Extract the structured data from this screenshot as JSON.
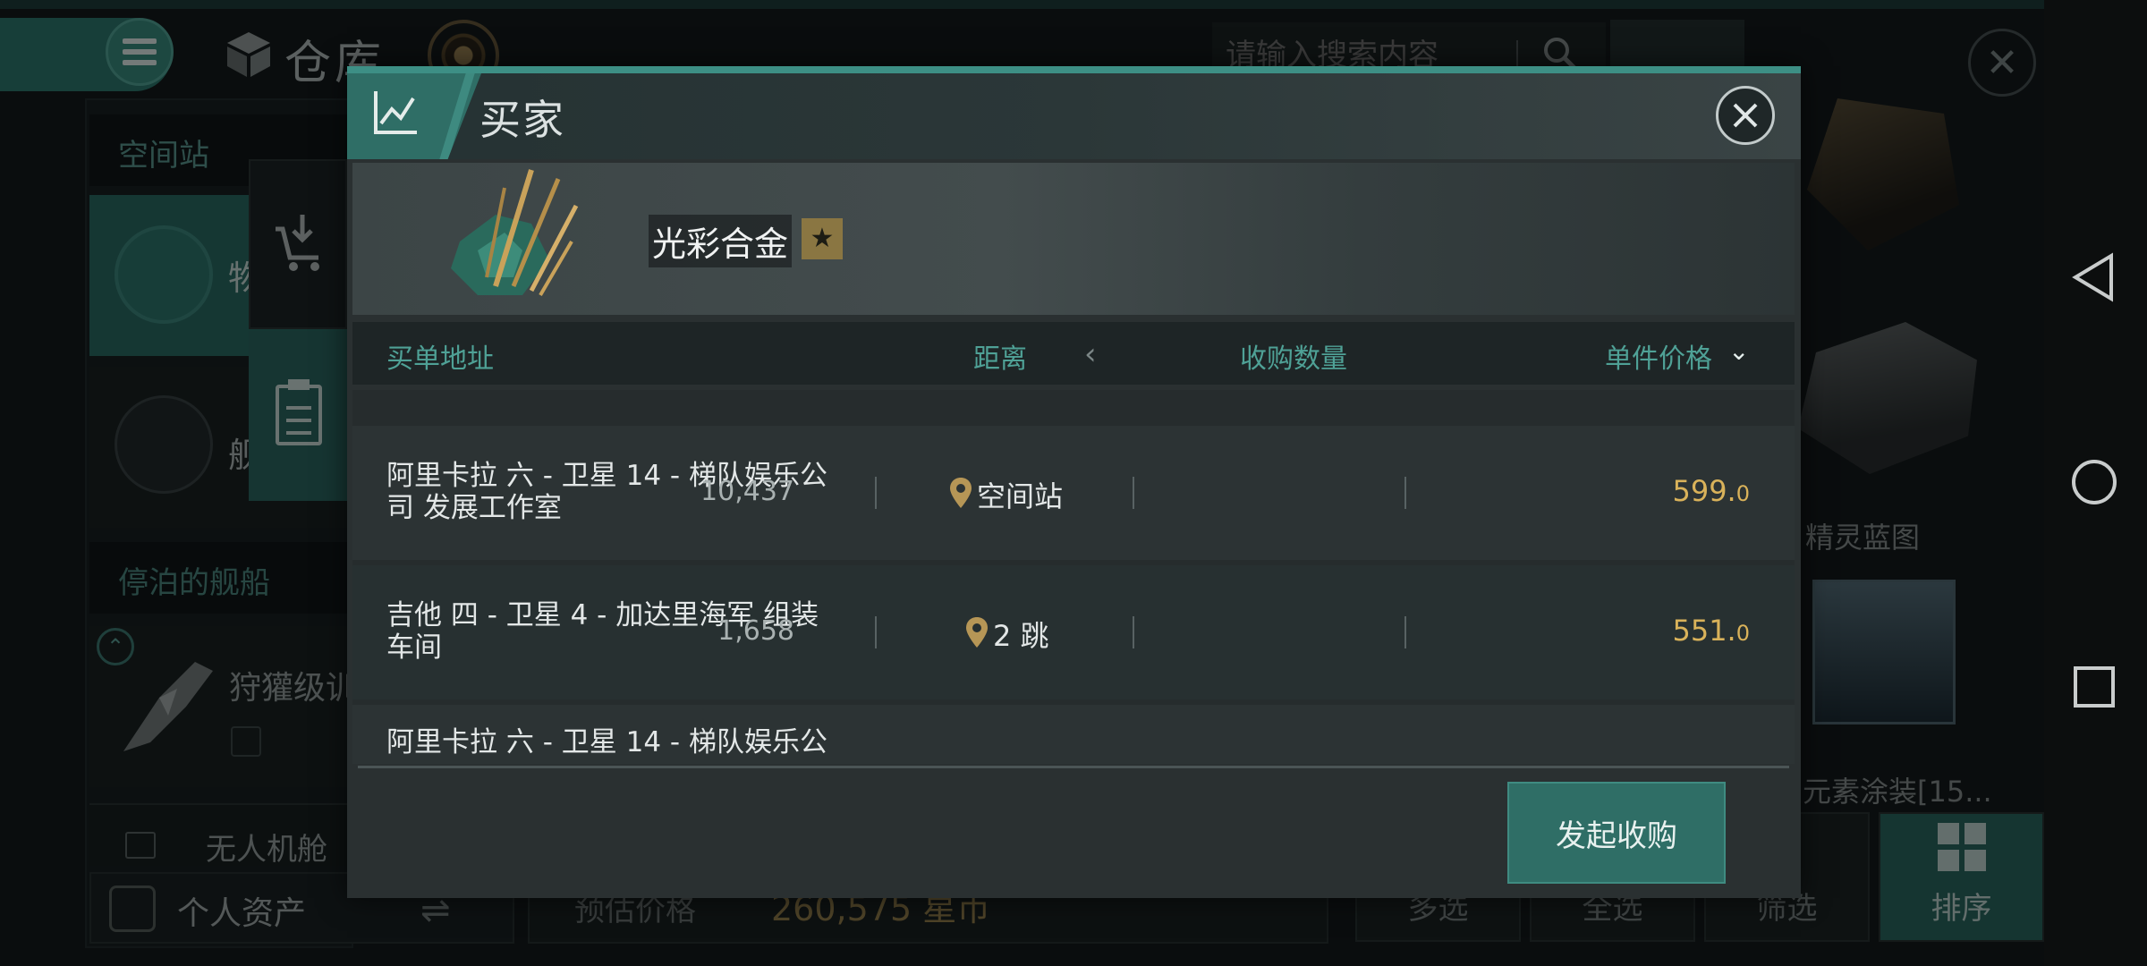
{
  "background": {
    "title": "仓库",
    "search_placeholder": "请输入搜索内容",
    "left_panel": {
      "station_header": "空间站",
      "station_item": "物",
      "ship_item": "舰",
      "docked_header": "停泊的舰船",
      "vessel_label": "狩獾级训",
      "drone_label": "无人机舱"
    },
    "assets_label": "个人资产",
    "estimate_label": "预估价格",
    "estimate_value": "260,575 星币",
    "right_panel": {
      "item_label_1": "精灵蓝图",
      "item_label_2": "元素涂装[15..."
    },
    "bottom_buttons": [
      "多选",
      "全选",
      "筛选",
      "排序"
    ]
  },
  "modal": {
    "title": "买家",
    "item_name": "光彩合金",
    "columns": {
      "address": "买单地址",
      "distance": "距离",
      "quantity": "收购数量",
      "price": "单件价格"
    },
    "rows": [
      {
        "address": "阿里卡拉 六 - 卫星 14 - 梯队娱乐公司 发展工作室",
        "distance": "空间站",
        "quantity": "10,437",
        "price_int": "599.",
        "price_dec": "0"
      },
      {
        "address": "吉他 四 - 卫星 4 - 加达里海军 组装车间",
        "distance": "2 跳",
        "quantity": "1,658",
        "price_int": "551.",
        "price_dec": "0"
      },
      {
        "address": "阿里卡拉 六 - 卫星 14 - 梯队娱乐公",
        "distance": "",
        "quantity": "",
        "price_int": "",
        "price_dec": ""
      }
    ],
    "action_button": "发起收购"
  },
  "colors": {
    "accent": "#2f6e66",
    "price": "#d9b25a",
    "header_text": "#4fa196"
  }
}
